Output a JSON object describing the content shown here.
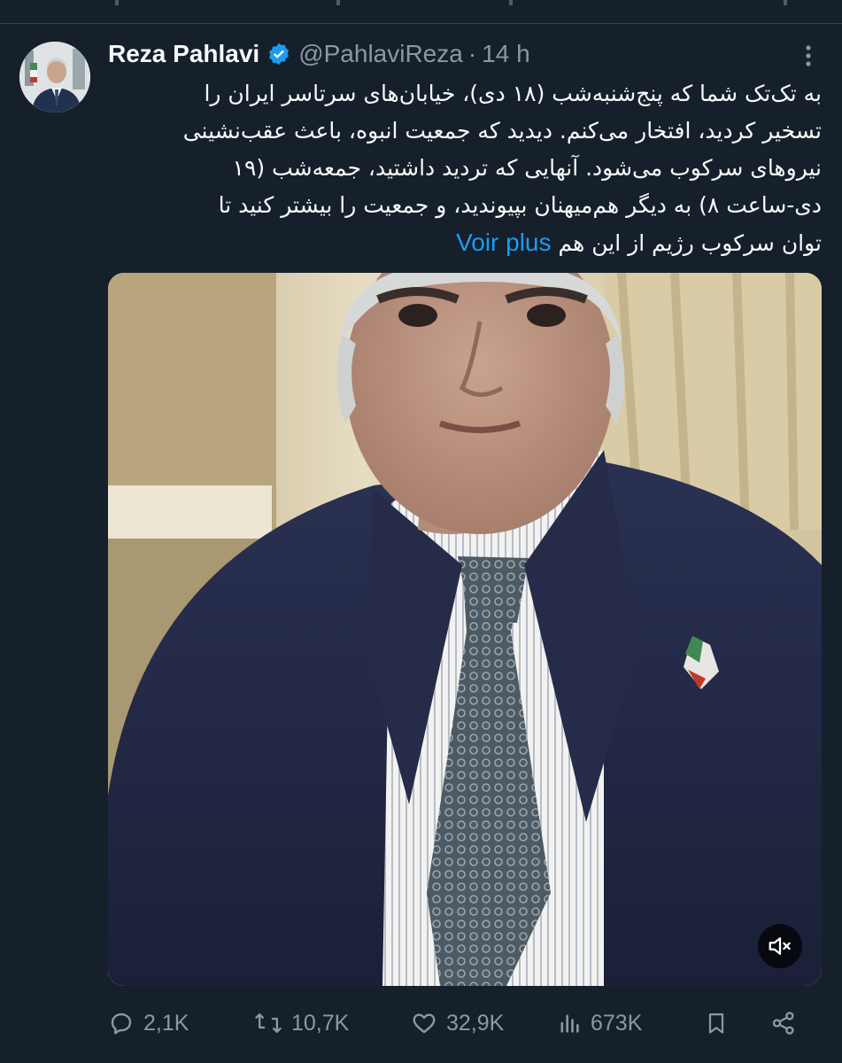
{
  "tweet": {
    "author_name": "Reza Pahlavi",
    "handle": "@PahlaviReza",
    "separator": "·",
    "time_ago": "14 h",
    "text_lines": [
      "به تک‌تک شما که پنج‌شنبه‌شب (۱۸ دی)، خیابان‌های سرتاسر ایران را",
      "تسخیر کردید، افتخار می‌کنم. دیدید که جمعیت انبوه، باعث عقب‌نشینی",
      "نیروهای سرکوب می‌شود. آنهایی که تردید داشتید، جمعه‌شب (۱۹",
      "دی-ساعت ۸) به دیگر هم‌میهنان بپیوندید، و جمعیت را بیشتر کنید تا",
      "توان سرکوب رژیم از این هم"
    ],
    "show_more": "Voir plus"
  },
  "actions": {
    "replies": "2,1K",
    "reposts": "10,7K",
    "likes": "32,9K",
    "views": "673K"
  },
  "colors": {
    "background": "#15202b",
    "text_primary": "#f7f9f9",
    "text_secondary": "#8b98a5",
    "accent": "#1d9bf0",
    "border": "#38444d"
  },
  "icons": [
    "verified-badge-icon",
    "more-options-icon",
    "mute-icon",
    "reply-icon",
    "repost-icon",
    "like-icon",
    "views-icon",
    "bookmark-icon",
    "share-icon"
  ]
}
